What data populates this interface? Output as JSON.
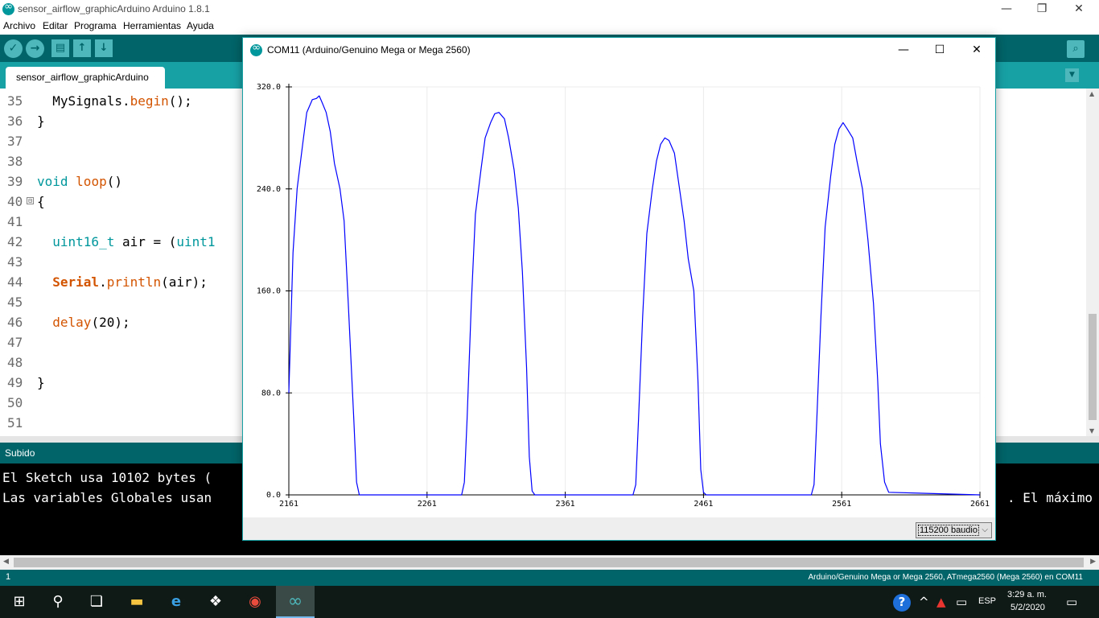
{
  "window": {
    "title": "sensor_airflow_graphicArduino Arduino 1.8.1",
    "minimize": "—",
    "maximize": "❐",
    "close": "✕"
  },
  "menu": [
    "Archivo",
    "Editar",
    "Programa",
    "Herramientas",
    "Ayuda"
  ],
  "toolbar": {
    "verify": "✓",
    "upload": "→",
    "new": "▤",
    "open": "↑",
    "save": "↓",
    "serial_monitor": "⌕"
  },
  "tab": {
    "name": "sensor_airflow_graphicArduino",
    "menu": "▼"
  },
  "editor": {
    "line_numbers": [
      "35",
      "36",
      "37",
      "38",
      "39",
      "40",
      "41",
      "42",
      "43",
      "44",
      "45",
      "46",
      "47",
      "48",
      "49",
      "50",
      "51"
    ],
    "fold_marker": "⊟",
    "code": {
      "l35_obj": "MySignals",
      "l35_dot": ".",
      "l35_fn": "begin",
      "l35_rest": "();",
      "l36": "}",
      "l39_type": "void",
      "l39_fn": "loop",
      "l39_rest": "()",
      "l40": "{",
      "l42_type": "uint16_t",
      "l42_mid": " air = (",
      "l42_type2": "uint1",
      "l44_obj": "Serial",
      "l44_dot": ".",
      "l44_fn": "println",
      "l44_rest": "(air);",
      "l46_fn": "delay",
      "l46_rest": "(20);",
      "l49": "}"
    }
  },
  "status": {
    "message": "Subido"
  },
  "console": {
    "line1": "El Sketch usa 10102 bytes (",
    "line2": "Las variables Globales usan",
    "line2_right": ". El máximo"
  },
  "board": {
    "line": "1",
    "info": "Arduino/Genuino Mega or Mega 2560, ATmega2560 (Mega 2560) en COM11"
  },
  "plotter": {
    "title": "COM11 (Arduino/Genuino Mega or Mega 2560)",
    "baud": "115200 baudio",
    "caret": "⌵",
    "minimize": "—",
    "maximize": "☐",
    "close": "✕"
  },
  "chart_data": {
    "type": "line",
    "title": "",
    "xlabel": "",
    "ylabel": "",
    "xlim": [
      2161,
      2661
    ],
    "ylim": [
      0,
      320
    ],
    "x_ticks": [
      "2161",
      "2261",
      "2361",
      "2461",
      "2561",
      "2661"
    ],
    "y_ticks": [
      "0.0",
      "80.0",
      "160.0",
      "240.0",
      "320.0"
    ],
    "grid": true,
    "series": [
      {
        "color": "#0000ff",
        "x": [
          2161,
          2164,
          2167,
          2171,
          2174,
          2178,
          2181,
          2183,
          2185,
          2188,
          2191,
          2194,
          2198,
          2201,
          2204,
          2208,
          2210,
          2212,
          2214,
          2216,
          2286,
          2288,
          2290,
          2293,
          2296,
          2300,
          2303,
          2307,
          2310,
          2313,
          2317,
          2320,
          2324,
          2327,
          2330,
          2333,
          2335,
          2337,
          2339,
          2341,
          2410,
          2412,
          2414,
          2417,
          2420,
          2424,
          2427,
          2430,
          2433,
          2436,
          2440,
          2443,
          2447,
          2450,
          2454,
          2457,
          2459,
          2461,
          2463,
          2539,
          2541,
          2543,
          2546,
          2549,
          2553,
          2556,
          2559,
          2562,
          2565,
          2569,
          2572,
          2576,
          2580,
          2584,
          2587,
          2589,
          2592,
          2595,
          2661
        ],
        "y": [
          80,
          190,
          240,
          275,
          300,
          310,
          311,
          313,
          308,
          300,
          285,
          260,
          240,
          215,
          150,
          60,
          10,
          0,
          0,
          0,
          0,
          10,
          60,
          150,
          220,
          255,
          280,
          292,
          299,
          300,
          295,
          280,
          255,
          225,
          175,
          100,
          30,
          3,
          0,
          0,
          0,
          8,
          60,
          140,
          205,
          240,
          262,
          275,
          280,
          278,
          268,
          245,
          215,
          185,
          160,
          90,
          20,
          2,
          0,
          0,
          8,
          60,
          140,
          210,
          250,
          275,
          287,
          292,
          287,
          280,
          262,
          240,
          200,
          150,
          90,
          40,
          10,
          2,
          0
        ]
      }
    ]
  },
  "taskbar": {
    "start": "⊞",
    "search": "⚲",
    "taskview": "❏",
    "explorer": "▬",
    "ie": "e",
    "dropbox": "❖",
    "chrome": "◉",
    "arduino": "∞",
    "help": "?",
    "chevron": "^",
    "warning": "▲",
    "network": "▭",
    "lang": "ESP",
    "time": "3:29 a. m.",
    "date": "5/2/2020",
    "notifications": "▭"
  }
}
